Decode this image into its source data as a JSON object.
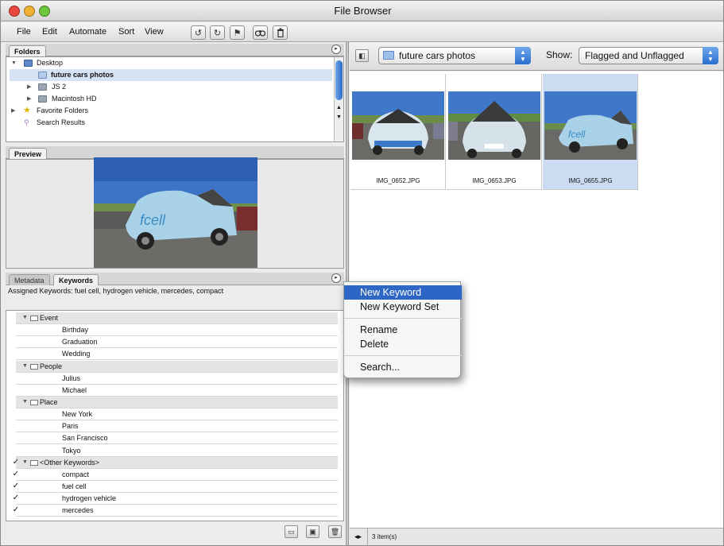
{
  "window": {
    "title": "File Browser"
  },
  "menubar": {
    "items": [
      "File",
      "Edit",
      "Automate",
      "Sort",
      "View"
    ]
  },
  "toolbar": {
    "icons": [
      "rotate-ccw-icon",
      "rotate-cw-icon",
      "flag-icon",
      "binoculars-icon",
      "trash-icon"
    ]
  },
  "folders": {
    "tab_label": "Folders",
    "tree": [
      {
        "label": "Desktop",
        "expanded": true
      },
      {
        "label": "future cars photos",
        "selected": true
      },
      {
        "label": "JS 2"
      },
      {
        "label": "Macintosh HD"
      },
      {
        "label": "Favorite Folders"
      },
      {
        "label": "Search Results"
      }
    ]
  },
  "preview": {
    "tab_label": "Preview"
  },
  "keywords_panel": {
    "tabs": [
      "Metadata",
      "Keywords"
    ],
    "assigned_text": "Assigned Keywords: fuel cell, hydrogen vehicle, mercedes, compact",
    "sets": [
      {
        "name": "Event",
        "items": [
          "Birthday",
          "Graduation",
          "Wedding"
        ]
      },
      {
        "name": "People",
        "items": [
          "Julius",
          "Michael"
        ]
      },
      {
        "name": "Place",
        "items": [
          "New York",
          "Paris",
          "San Francisco",
          "Tokyo"
        ]
      },
      {
        "name": "<Other Keywords>",
        "checked": true,
        "items": [
          "compact",
          "fuel cell",
          "hydrogen vehicle",
          "mercedes"
        ]
      }
    ],
    "check_glyph": "✓"
  },
  "browser": {
    "location": "future cars photos",
    "show_label": "Show:",
    "show_value": "Flagged and Unflagged",
    "thumbnails": [
      {
        "filename": "IMG_0652.JPG",
        "selected": false
      },
      {
        "filename": "IMG_0653.JPG",
        "selected": false
      },
      {
        "filename": "IMG_0655.JPG",
        "selected": true
      }
    ],
    "status": "3 item(s)"
  },
  "context_menu": {
    "items": [
      "New Keyword",
      "New Keyword Set",
      "Rename",
      "Delete",
      "Search..."
    ],
    "highlighted_index": 0
  },
  "colors": {
    "selection": "#cbdcf2",
    "menu_highlight": "#2d66c4",
    "tree_highlight": "#d5e3f5"
  }
}
